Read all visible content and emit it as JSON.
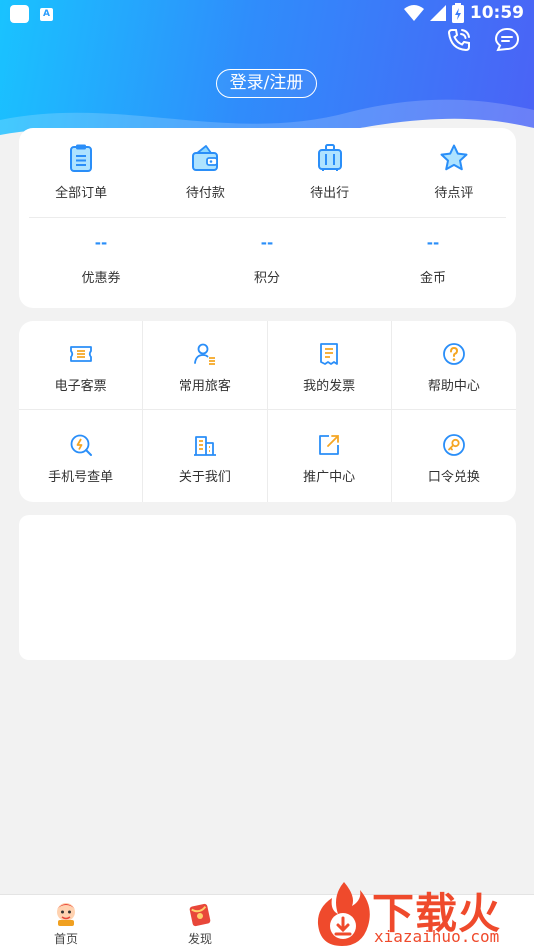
{
  "status_bar": {
    "time": "10:59",
    "app_badge": "A"
  },
  "header": {
    "login_label": "登录/注册"
  },
  "orders": [
    {
      "label": "全部订单",
      "icon": "clipboard-icon"
    },
    {
      "label": "待付款",
      "icon": "wallet-icon"
    },
    {
      "label": "待出行",
      "icon": "luggage-icon"
    },
    {
      "label": "待点评",
      "icon": "star-icon"
    }
  ],
  "assets": [
    {
      "value": "--",
      "label": "优惠券"
    },
    {
      "value": "--",
      "label": "积分"
    },
    {
      "value": "--",
      "label": "金币"
    }
  ],
  "services": [
    {
      "label": "电子客票",
      "icon": "ticket-icon"
    },
    {
      "label": "常用旅客",
      "icon": "passenger-icon"
    },
    {
      "label": "我的发票",
      "icon": "invoice-icon"
    },
    {
      "label": "帮助中心",
      "icon": "help-icon"
    },
    {
      "label": "手机号查单",
      "icon": "phone-search-icon"
    },
    {
      "label": "关于我们",
      "icon": "building-icon"
    },
    {
      "label": "推广中心",
      "icon": "share-icon"
    },
    {
      "label": "口令兑换",
      "icon": "key-icon"
    }
  ],
  "tabbar": [
    {
      "label": "首页",
      "icon": "home-mascot-icon"
    },
    {
      "label": "发现",
      "icon": "discover-icon"
    }
  ],
  "watermark": {
    "text": "下载火",
    "url": "xiazaihuo.com"
  },
  "colors": {
    "accent": "#2a8ef8",
    "icon_orange": "#f5a623",
    "header_start": "#19c3ff",
    "header_end": "#4b62f6",
    "watermark": "#ef4a2c"
  }
}
